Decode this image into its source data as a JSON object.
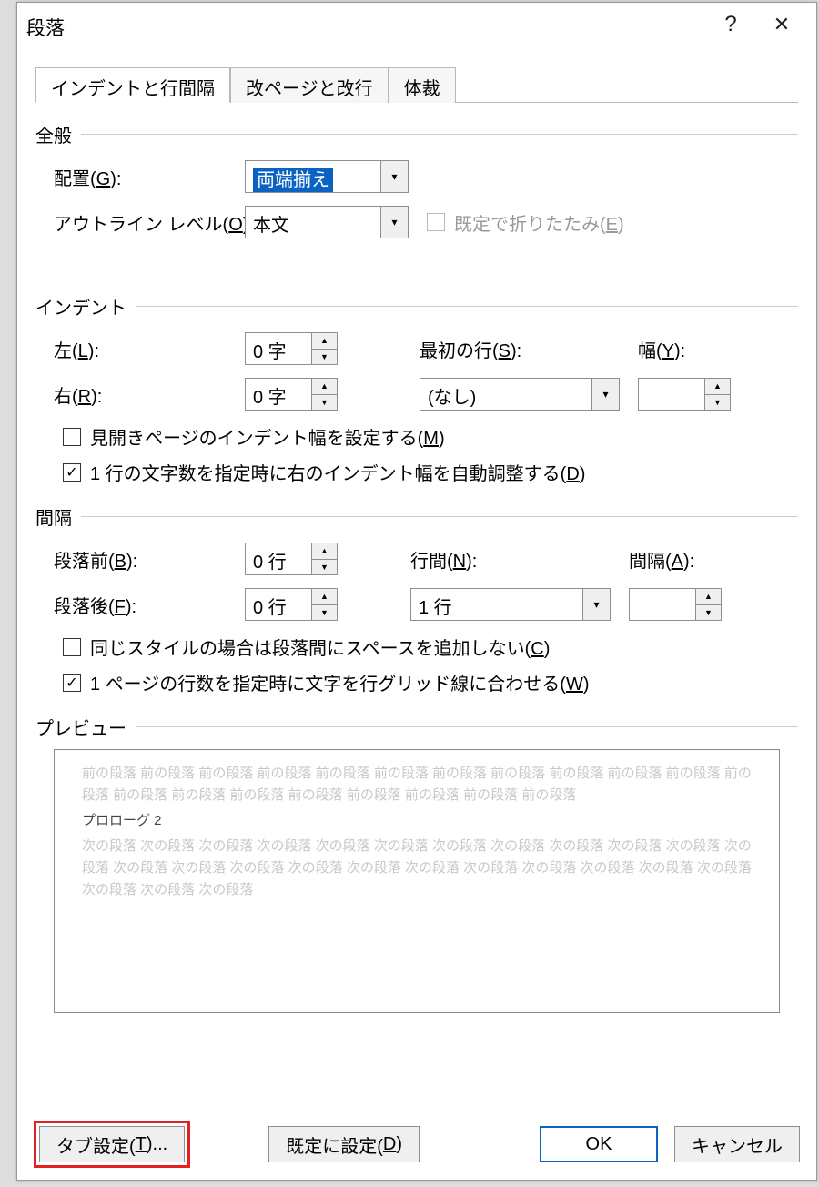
{
  "title": "段落",
  "tabs": {
    "t1": "インデントと行間隔",
    "t2": "改ページと改行",
    "t3": "体裁"
  },
  "sec": {
    "general": "全般",
    "indent": "インデント",
    "spacing": "間隔",
    "preview": "プレビュー"
  },
  "labels": {
    "align": "配置(",
    "align_k": "G",
    "align_e": "):",
    "outline": "アウトライン レベル(",
    "outline_k": "O",
    "outline_e": "):",
    "collapse": "既定で折りたたみ(",
    "collapse_k": "E",
    "collapse_e": ")",
    "left": "左(",
    "left_k": "L",
    "left_e": "):",
    "right": "右(",
    "right_k": "R",
    "right_e": "):",
    "firstline": "最初の行(",
    "firstline_k": "S",
    "firstline_e": "):",
    "by": "幅(",
    "by_k": "Y",
    "by_e": "):",
    "mirror": "見開きページのインデント幅を設定する(",
    "mirror_k": "M",
    "mirror_e": ")",
    "autoright": "1 行の文字数を指定時に右のインデント幅を自動調整する(",
    "autoright_k": "D",
    "autoright_e": ")",
    "before": "段落前(",
    "before_k": "B",
    "before_e": "):",
    "after": "段落後(",
    "after_k": "F",
    "after_e": "):",
    "linespace": "行間(",
    "linespace_k": "N",
    "linespace_e": "):",
    "at": "間隔(",
    "at_k": "A",
    "at_e": "):",
    "nosame": "同じスタイルの場合は段落間にスペースを追加しない(",
    "nosame_k": "C",
    "nosame_e": ")",
    "snap": "1 ページの行数を指定時に文字を行グリッド線に合わせる(",
    "snap_k": "W",
    "snap_e": ")"
  },
  "values": {
    "align": "両端揃え",
    "outline": "本文",
    "left": "0 字",
    "right": "0 字",
    "firstline": "(なし)",
    "by": "",
    "before": "0 行",
    "after": "0 行",
    "linespace": "1 行",
    "at": ""
  },
  "preview": {
    "prev": "前の段落 前の段落 前の段落 前の段落 前の段落 前の段落 前の段落 前の段落 前の段落 前の段落 前の段落 前の段落 前の段落 前の段落 前の段落 前の段落 前の段落 前の段落 前の段落 前の段落",
    "sample": "プロローグ 2",
    "next": "次の段落 次の段落 次の段落 次の段落 次の段落 次の段落 次の段落 次の段落 次の段落 次の段落 次の段落 次の段落 次の段落 次の段落 次の段落 次の段落 次の段落 次の段落 次の段落 次の段落 次の段落 次の段落 次の段落 次の段落 次の段落 次の段落"
  },
  "buttons": {
    "tabs": "タブ設定(",
    "tabs_k": "T",
    "tabs_e": ")...",
    "default": "既定に設定(",
    "default_k": "D",
    "default_e": ")",
    "ok": "OK",
    "cancel": "キャンセル"
  }
}
